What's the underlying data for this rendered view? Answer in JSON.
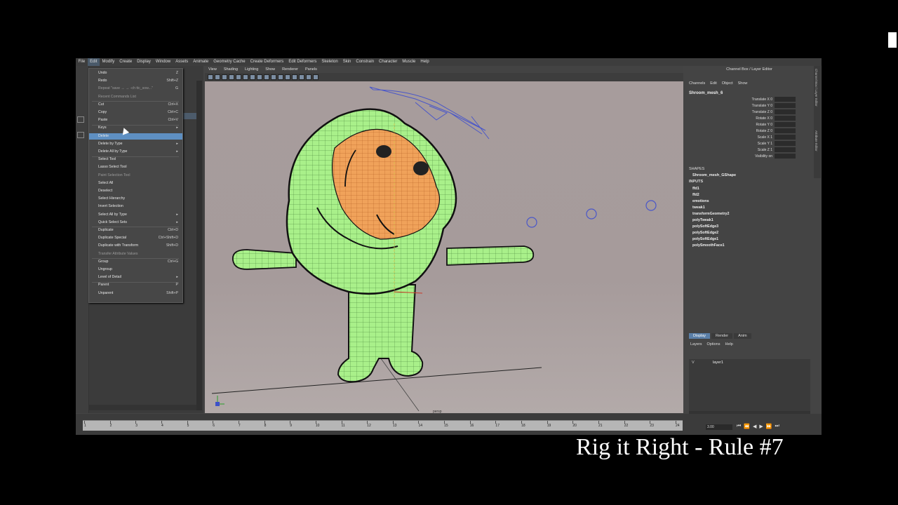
{
  "caption": "Rig it Right - Rule #7",
  "menubar": [
    "File",
    "Edit",
    "Modify",
    "Create",
    "Display",
    "Window",
    "Assets",
    "Animate",
    "Geometry Cache",
    "Create Deformers",
    "Edit Deformers",
    "Skeleton",
    "Skin",
    "Constrain",
    "Character",
    "Muscle",
    "Help"
  ],
  "edit_menu": [
    {
      "label": "Undo",
      "shortcut": "Z"
    },
    {
      "label": "Redo",
      "shortcut": "Shift+Z"
    },
    {
      "label": "Repeat \"save → → -ch ttc_sow...\"",
      "shortcut": "G"
    },
    {
      "label": "Recent Commands List",
      "shortcut": ""
    },
    {
      "label": "Cut",
      "shortcut": "Ctrl+X"
    },
    {
      "label": "Copy",
      "shortcut": "Ctrl+C"
    },
    {
      "label": "Paste",
      "shortcut": "Ctrl+V"
    },
    {
      "label": "Keys",
      "shortcut": "▸"
    },
    {
      "label": "Delete",
      "shortcut": ""
    },
    {
      "label": "Delete by Type",
      "shortcut": "▸"
    },
    {
      "label": "Delete All by Type",
      "shortcut": "▸"
    },
    {
      "label": "Select Tool",
      "shortcut": ""
    },
    {
      "label": "Lasso Select Tool",
      "shortcut": ""
    },
    {
      "label": "Paint Selection Tool",
      "shortcut": ""
    },
    {
      "label": "Select All",
      "shortcut": ""
    },
    {
      "label": "Deselect",
      "shortcut": ""
    },
    {
      "label": "Select Hierarchy",
      "shortcut": ""
    },
    {
      "label": "Invert Selection",
      "shortcut": ""
    },
    {
      "label": "Select All by Type",
      "shortcut": "▸"
    },
    {
      "label": "Quick Select Sets",
      "shortcut": "▸"
    },
    {
      "label": "Duplicate",
      "shortcut": "Ctrl+D"
    },
    {
      "label": "Duplicate Special",
      "shortcut": "Ctrl+Shift+D"
    },
    {
      "label": "Duplicate with Transform",
      "shortcut": "Shift+D"
    },
    {
      "label": "Transfer Attribute Values",
      "shortcut": ""
    },
    {
      "label": "Group",
      "shortcut": "Ctrl+G"
    },
    {
      "label": "Ungroup",
      "shortcut": ""
    },
    {
      "label": "Level of Detail",
      "shortcut": "▸"
    },
    {
      "label": "Parent",
      "shortcut": "P"
    },
    {
      "label": "Unparent",
      "shortcut": "Shift+P"
    }
  ],
  "viewport": {
    "menu": [
      "View",
      "Shading",
      "Lighting",
      "Show",
      "Renderer",
      "Panels"
    ],
    "camera_label": "persp"
  },
  "channel_box": {
    "title": "Channel Box / Layer Editor",
    "menu": [
      "Channels",
      "Edit",
      "Object",
      "Show"
    ],
    "node": "Shroom_mesh_6",
    "attributes": [
      {
        "name": "Translate X",
        "value": "0"
      },
      {
        "name": "Translate Y",
        "value": "0"
      },
      {
        "name": "Translate Z",
        "value": "0"
      },
      {
        "name": "Rotate X",
        "value": "0"
      },
      {
        "name": "Rotate Y",
        "value": "0"
      },
      {
        "name": "Rotate Z",
        "value": "0"
      },
      {
        "name": "Scale X",
        "value": "1"
      },
      {
        "name": "Scale Y",
        "value": "1"
      },
      {
        "name": "Scale Z",
        "value": "1"
      },
      {
        "name": "Visibility",
        "value": "on"
      }
    ],
    "shapes_label": "SHAPES",
    "shape_name": "Shroom_mesh_GShape",
    "inputs_label": "INPUTS",
    "inputs": [
      "ffd1",
      "ffd2",
      "emotions",
      "tweak1",
      "transformGeometry2",
      "polyTweak1",
      "polySoftEdge3",
      "polySoftEdge2",
      "polySoftEdge1",
      "polySmoothFace1"
    ],
    "side_tabs": [
      "Channel Box / Layer Editor",
      "Attribute Editor"
    ]
  },
  "layer_editor": {
    "tabs": [
      "Display",
      "Render",
      "Anim"
    ],
    "menu": [
      "Layers",
      "Options",
      "Help"
    ],
    "layer_visible": "V",
    "layer_name": "layer1"
  },
  "timeline": {
    "ticks": [
      "1",
      "2",
      "3",
      "4",
      "5",
      "6",
      "7",
      "8",
      "9",
      "10",
      "11",
      "12",
      "13",
      "14",
      "15",
      "16",
      "17",
      "18",
      "19",
      "20",
      "21",
      "22",
      "23",
      "24"
    ],
    "current_time": "3.00"
  },
  "colors": {
    "mesh_fill": "#a9f08a",
    "wire": "#3f7a35",
    "face_orange": "#f0a25a",
    "control_blue": "#4a57c9",
    "highlight": "#5e8fc2"
  }
}
